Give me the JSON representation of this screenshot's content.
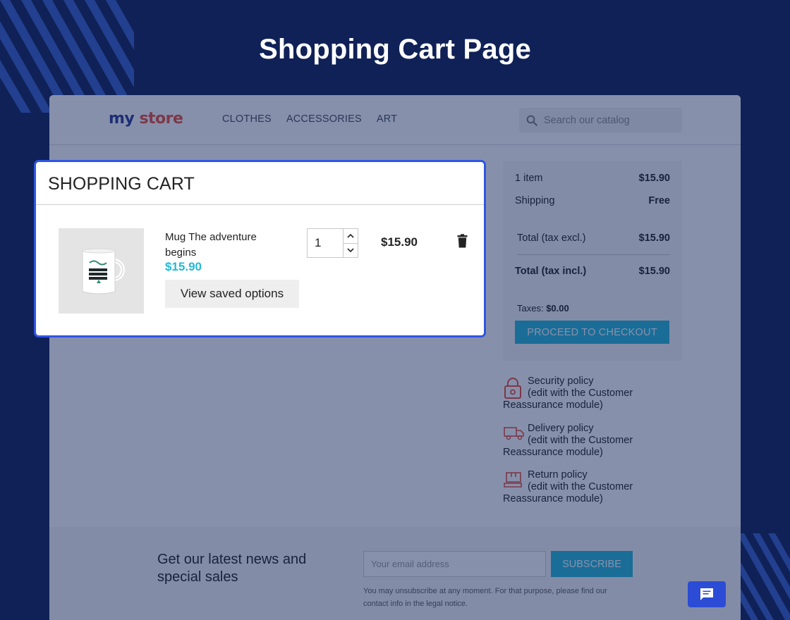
{
  "page_title": "Shopping Cart Page",
  "store": {
    "logo_part1": "my",
    "logo_part2": "store",
    "nav": [
      "CLOTHES",
      "ACCESSORIES",
      "ART"
    ],
    "search_placeholder": "Search our catalog"
  },
  "cart": {
    "title": "SHOPPING CART",
    "item": {
      "name": "Mug The adventure begins",
      "price": "$15.90",
      "saved_options_label": "View saved options",
      "quantity": "1",
      "line_total": "$15.90"
    }
  },
  "summary": {
    "items_label": "1 item",
    "items_value": "$15.90",
    "shipping_label": "Shipping",
    "shipping_value": "Free",
    "total_excl_label": "Total (tax excl.)",
    "total_excl_value": "$15.90",
    "total_incl_label": "Total (tax incl.)",
    "total_incl_value": "$15.90",
    "taxes_label": "Taxes:",
    "taxes_value": "$0.00",
    "checkout_label": "PROCEED TO CHECKOUT"
  },
  "reassurance": [
    {
      "title": "Security policy",
      "sub": "(edit with the Customer Reassurance module)",
      "icon": "lock-icon"
    },
    {
      "title": "Delivery policy",
      "sub": "(edit with the Customer Reassurance module)",
      "icon": "truck-icon"
    },
    {
      "title": "Return policy",
      "sub": "(edit with the Customer Reassurance module)",
      "icon": "return-box-icon"
    }
  ],
  "newsletter": {
    "text": "Get our latest news and special sales",
    "email_placeholder": "Your email address",
    "subscribe_label": "SUBSCRIBE",
    "legal": "You may unsubscribe at any moment. For that purpose, please find our contact info in the legal notice."
  },
  "colors": {
    "background": "#102157",
    "highlight_border": "#2f55e4",
    "accent": "#24b9d7",
    "chat_button": "#2c4cd6"
  }
}
